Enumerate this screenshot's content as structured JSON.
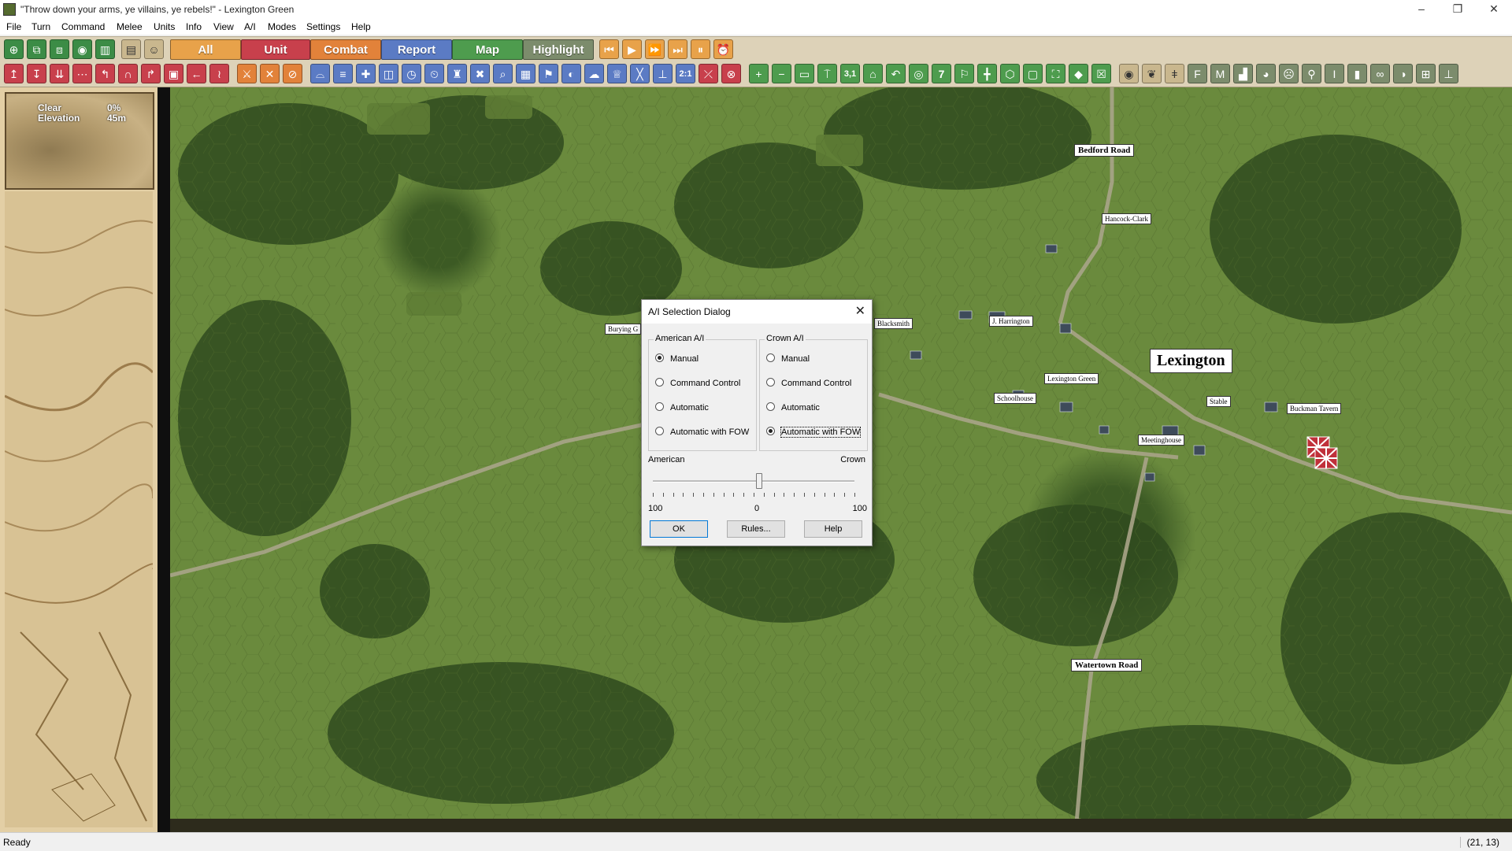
{
  "window": {
    "title": "\"Throw down your arms, ye villains, ye rebels!\" - Lexington Green",
    "minimize": "–",
    "restore": "❐",
    "close": "✕"
  },
  "menu": [
    "File",
    "Turn",
    "Command",
    "Melee",
    "Units",
    "Info",
    "View",
    "A/I",
    "Modes",
    "Settings",
    "Help"
  ],
  "mode_buttons": [
    {
      "label": "All",
      "color": "#e8a24a"
    },
    {
      "label": "Unit",
      "color": "#c8404c"
    },
    {
      "label": "Combat",
      "color": "#e2823a"
    },
    {
      "label": "Report",
      "color": "#5b7bc4"
    },
    {
      "label": "Map",
      "color": "#4e9c4e"
    },
    {
      "label": "Highlight",
      "color": "#7c8c6c"
    }
  ],
  "toolbar2_labels": {
    "ratio": "2:1",
    "number": "3,1",
    "seven": "7"
  },
  "terrain_info": {
    "type": "Clear",
    "elevation_label": "Elevation",
    "cover": "0%",
    "height": "45m"
  },
  "map": {
    "town": "Lexington",
    "roads": [
      "Bedford Road",
      "Watertown Road"
    ],
    "places": [
      "Hancock-Clark",
      "Burying G",
      "Blacksmith",
      "J. Harrington",
      "Lexington Green",
      "Schoolhouse",
      "Stable",
      "Buckman Tavern",
      "Meetinghouse"
    ]
  },
  "dialog": {
    "title": "A/I Selection Dialog",
    "american": {
      "title": "American A/I",
      "options": [
        "Manual",
        "Command Control",
        "Automatic",
        "Automatic with FOW"
      ],
      "selected": "Manual"
    },
    "crown": {
      "title": "Crown A/I",
      "options": [
        "Manual",
        "Command Control",
        "Automatic",
        "Automatic with FOW"
      ],
      "selected": "Automatic with FOW"
    },
    "slider": {
      "left_label": "American",
      "right_label": "Crown",
      "min_label": "100",
      "mid_label": "0",
      "max_label": "100",
      "value": 0
    },
    "buttons": {
      "ok": "OK",
      "rules": "Rules...",
      "help": "Help"
    }
  },
  "status": {
    "text": "Ready",
    "coords": "(21, 13)"
  }
}
